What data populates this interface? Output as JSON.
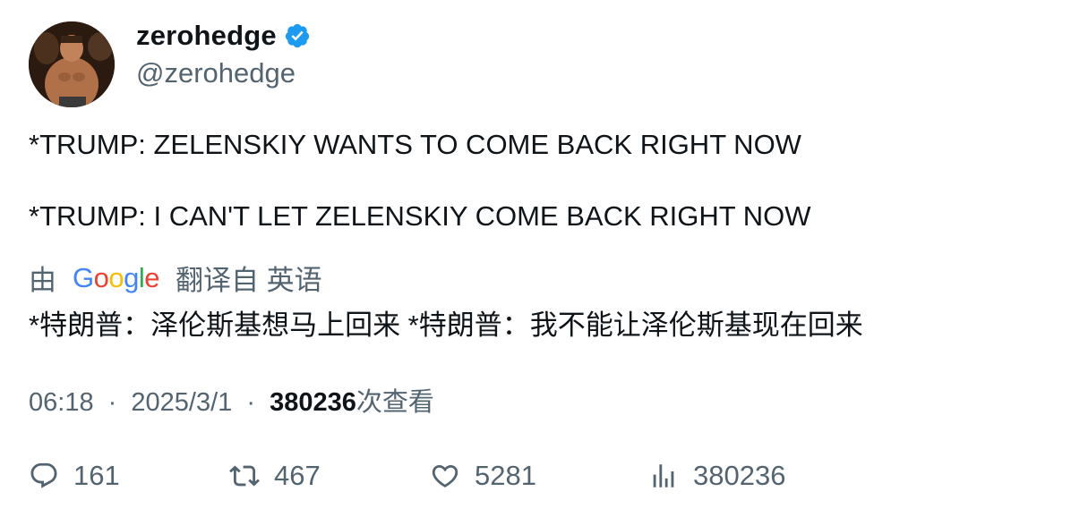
{
  "author": {
    "display_name": "zerohedge",
    "handle": "@zerohedge",
    "verified": true,
    "verified_color": "#1d9bf0"
  },
  "tweet": {
    "lines": [
      "*TRUMP: ZELENSKIY WANTS TO COME BACK RIGHT NOW",
      "*TRUMP: I CAN'T LET ZELENSKIY COME BACK RIGHT NOW"
    ]
  },
  "translation": {
    "prefix": "由",
    "provider": "Google",
    "suffix": "翻译自 英语",
    "text": "*特朗普：泽伦斯基想马上回来 *特朗普：我不能让泽伦斯基现在回来"
  },
  "meta": {
    "time": "06:18",
    "separator": "·",
    "date": "2025/3/1",
    "views_count": "380236",
    "views_label": "次查看"
  },
  "actions": {
    "reply": {
      "icon": "reply-icon",
      "count": "161"
    },
    "retweet": {
      "icon": "retweet-icon",
      "count": "467"
    },
    "like": {
      "icon": "heart-icon",
      "count": "5281"
    },
    "views": {
      "icon": "bar-chart-icon",
      "count": "380236"
    }
  },
  "colors": {
    "text_primary": "#0f1419",
    "text_secondary": "#536471",
    "google_blue": "#4285f4",
    "google_red": "#ea4335",
    "google_yellow": "#fbbc05",
    "google_green": "#34a853"
  }
}
